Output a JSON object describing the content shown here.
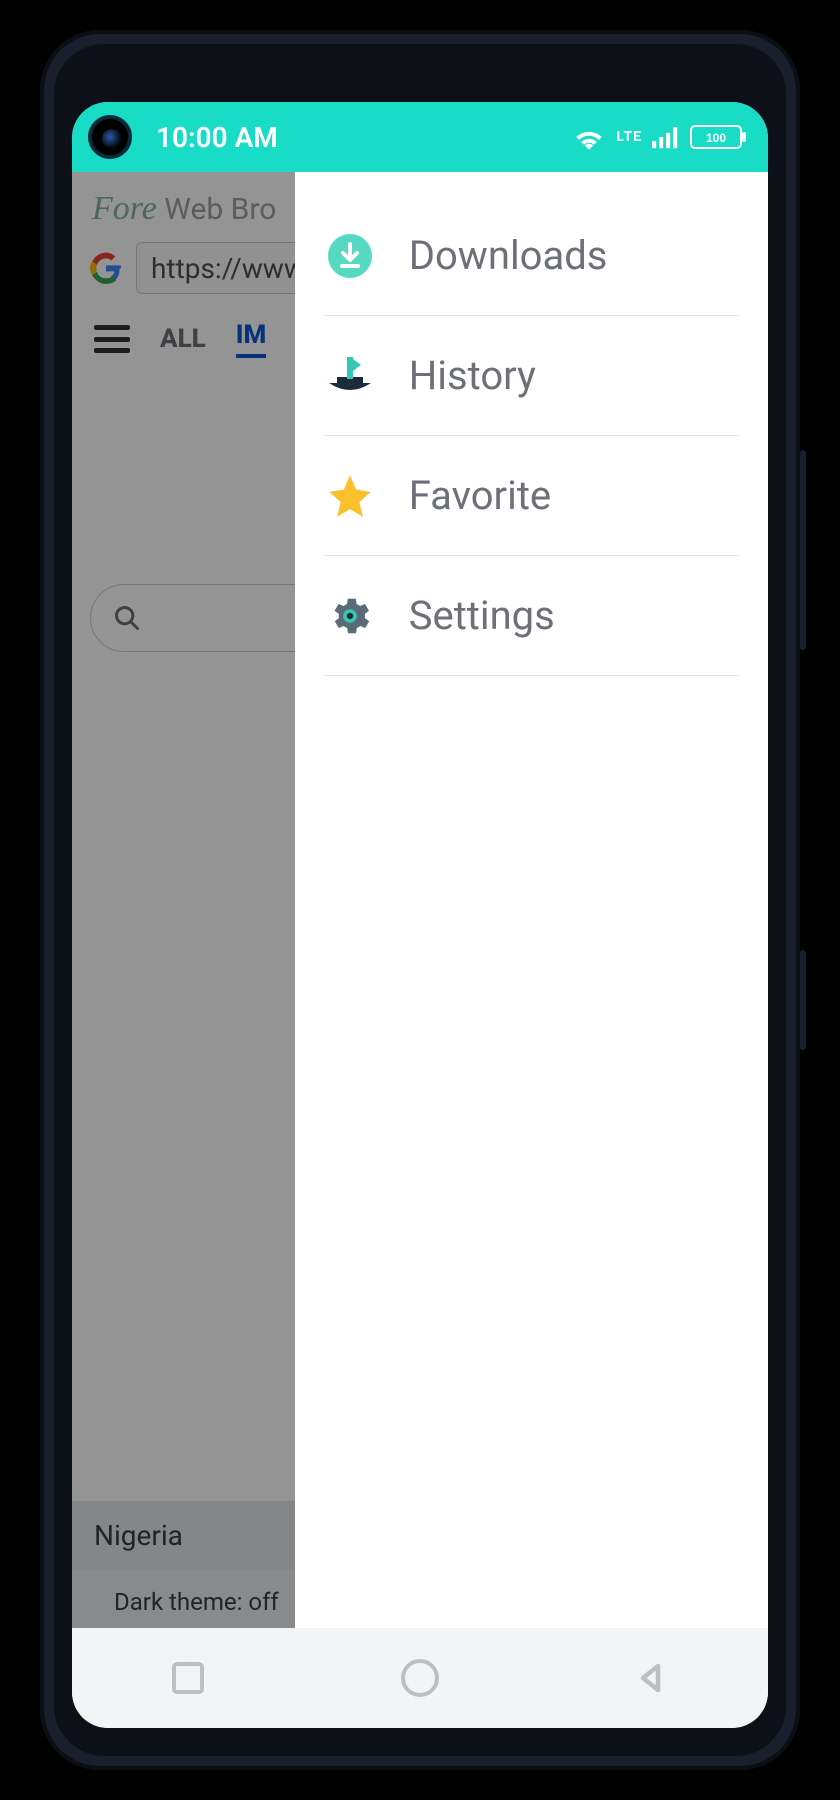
{
  "status": {
    "time": "10:00 AM",
    "net_label": "LTE",
    "battery": "100"
  },
  "app": {
    "brand": "Fore",
    "title_suffix": " Web Bro"
  },
  "url": "https://www.g",
  "tabs": {
    "all": "ALL",
    "images": "IM"
  },
  "drawer": {
    "items": [
      {
        "label": "Downloads",
        "icon": "download-icon"
      },
      {
        "label": "History",
        "icon": "history-boat-icon"
      },
      {
        "label": "Favorite",
        "icon": "star-icon"
      },
      {
        "label": "Settings",
        "icon": "gear-icon"
      }
    ]
  },
  "footer": {
    "country": "Nigeria",
    "theme_line": "Dark theme: off"
  }
}
